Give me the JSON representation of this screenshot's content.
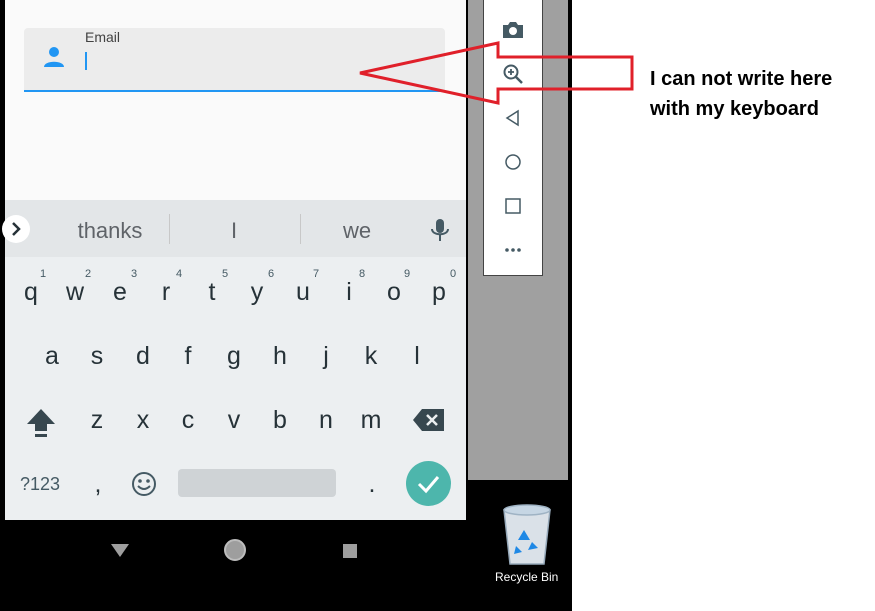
{
  "email_field": {
    "label": "Email",
    "value": ""
  },
  "keyboard": {
    "suggestions": [
      "thanks",
      "I",
      "we"
    ],
    "row1": [
      "q",
      "w",
      "e",
      "r",
      "t",
      "y",
      "u",
      "i",
      "o",
      "p"
    ],
    "row1_hints": [
      "1",
      "2",
      "3",
      "4",
      "5",
      "6",
      "7",
      "8",
      "9",
      "0"
    ],
    "row2": [
      "a",
      "s",
      "d",
      "f",
      "g",
      "h",
      "j",
      "k",
      "l"
    ],
    "row3": [
      "z",
      "x",
      "c",
      "v",
      "b",
      "n",
      "m"
    ],
    "symbols_label": "?123",
    "comma_label": ",",
    "period_label": "."
  },
  "desktop": {
    "recycle_bin_label": "Recycle Bin"
  },
  "annotation": {
    "text": "I can not write here with my keyboard"
  },
  "colors": {
    "accent": "#2196f3",
    "enter": "#4db6ac",
    "arrow": "#e0202a"
  }
}
